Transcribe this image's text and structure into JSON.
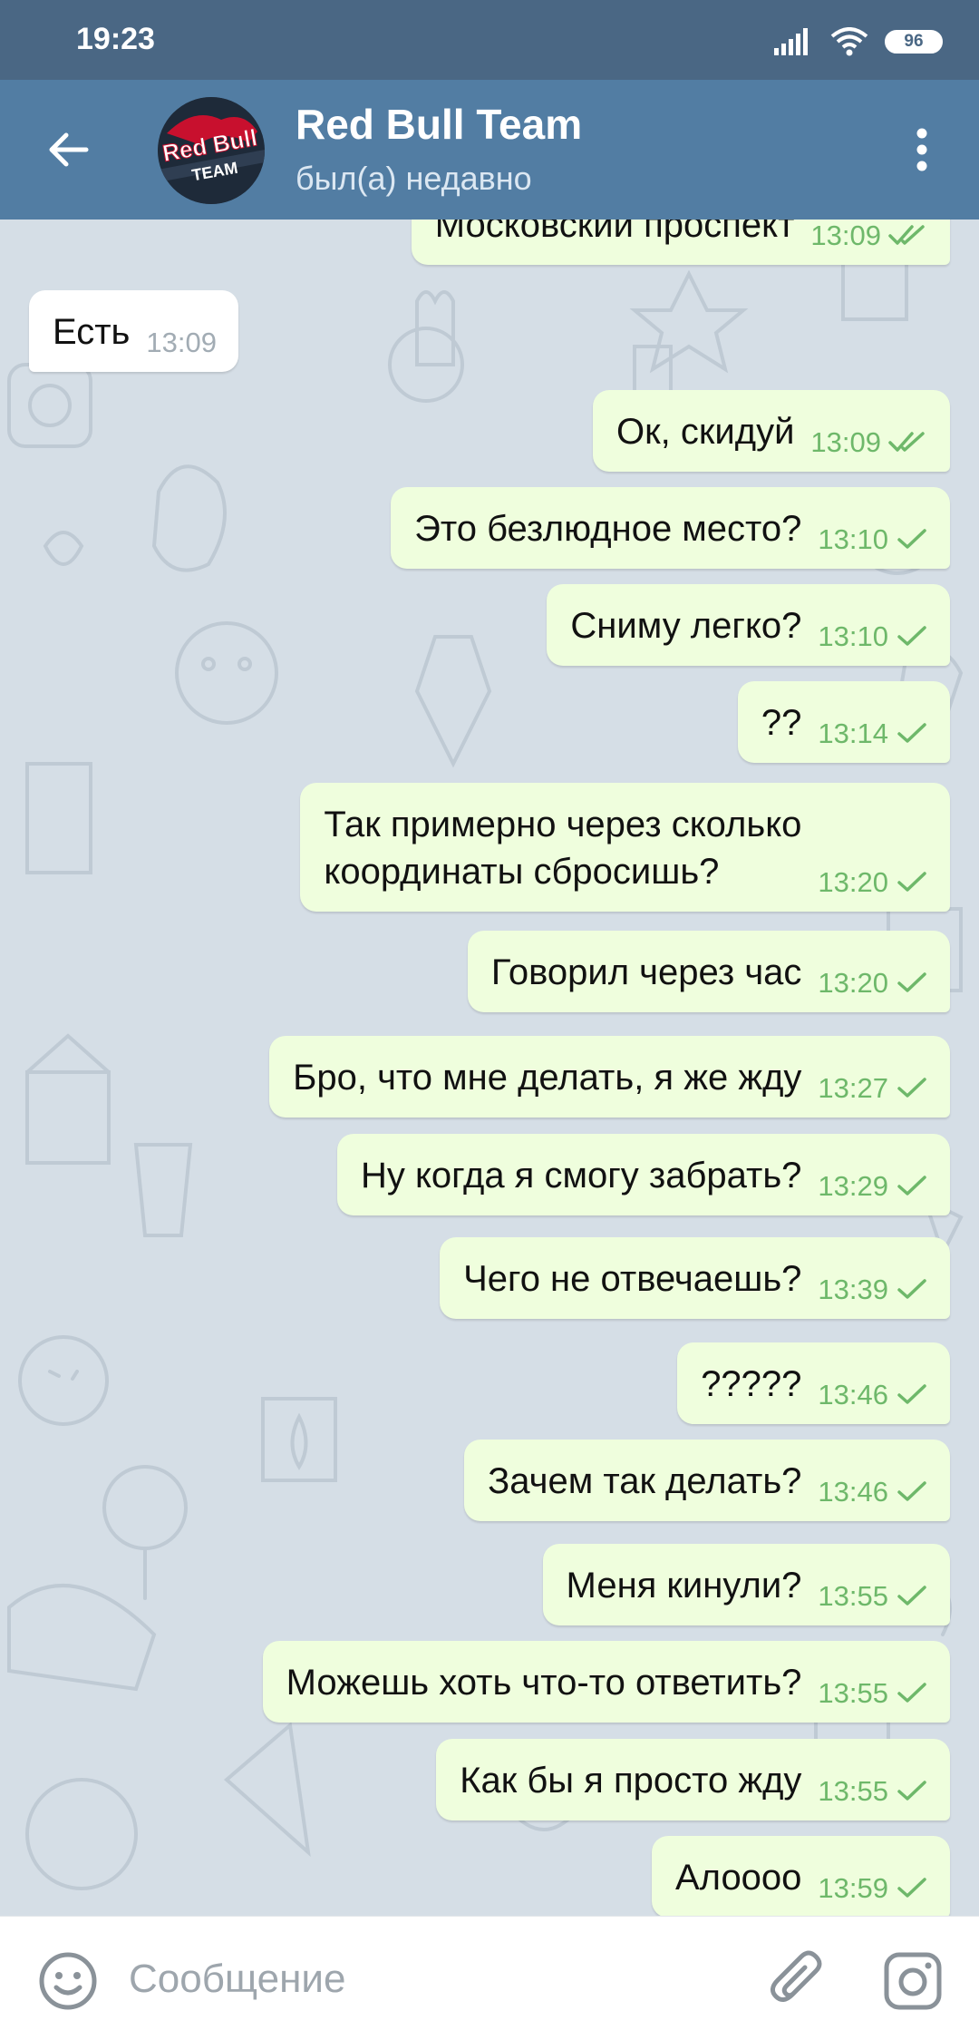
{
  "status_bar": {
    "time": "19:23",
    "battery": "96"
  },
  "header": {
    "title": "Red Bull Team",
    "subtitle": "был(а) недавно",
    "avatar_text_1": "Red Bull",
    "avatar_text_2": "TEAM"
  },
  "messages": [
    {
      "text": "Московский проспект",
      "time": "13:09",
      "dir": "out",
      "status": "read"
    },
    {
      "text": "Есть",
      "time": "13:09",
      "dir": "in"
    },
    {
      "text": "Ок, скидуй",
      "time": "13:09",
      "dir": "out",
      "status": "read"
    },
    {
      "text": "Это безлюдное место?",
      "time": "13:10",
      "dir": "out",
      "status": "sent"
    },
    {
      "text": "Сниму легко?",
      "time": "13:10",
      "dir": "out",
      "status": "sent"
    },
    {
      "text": "??",
      "time": "13:14",
      "dir": "out",
      "status": "sent"
    },
    {
      "text": "Так примерно через сколько\nкоординаты сбросишь?",
      "time": "13:20",
      "dir": "out",
      "status": "sent"
    },
    {
      "text": "Говорил через час",
      "time": "13:20",
      "dir": "out",
      "status": "sent"
    },
    {
      "text": "Бро, что мне делать, я же жду",
      "time": "13:27",
      "dir": "out",
      "status": "sent"
    },
    {
      "text": "Ну когда я смогу забрать?",
      "time": "13:29",
      "dir": "out",
      "status": "sent"
    },
    {
      "text": "Чего не отвечаешь?",
      "time": "13:39",
      "dir": "out",
      "status": "sent"
    },
    {
      "text": "?????",
      "time": "13:46",
      "dir": "out",
      "status": "sent"
    },
    {
      "text": "Зачем так делать?",
      "time": "13:46",
      "dir": "out",
      "status": "sent"
    },
    {
      "text": "Меня кинули?",
      "time": "13:55",
      "dir": "out",
      "status": "sent"
    },
    {
      "text": "Можешь хоть что-то ответить?",
      "time": "13:55",
      "dir": "out",
      "status": "sent"
    },
    {
      "text": "Как бы я просто жду",
      "time": "13:55",
      "dir": "out",
      "status": "sent"
    },
    {
      "text": "Алоооо",
      "time": "13:59",
      "dir": "out",
      "status": "sent"
    }
  ],
  "composer": {
    "placeholder": "Сообщение"
  },
  "colors": {
    "header": "#527da3",
    "statusbar": "#4a6784",
    "outgoing": "#effedd",
    "incoming": "#ffffff",
    "tick": "#6eb86a"
  },
  "icons": [
    "back-arrow-icon",
    "more-vertical-icon",
    "emoji-icon",
    "paperclip-icon",
    "camera-icon",
    "wifi-icon",
    "signal-icon",
    "double-check-icon",
    "single-check-icon"
  ]
}
